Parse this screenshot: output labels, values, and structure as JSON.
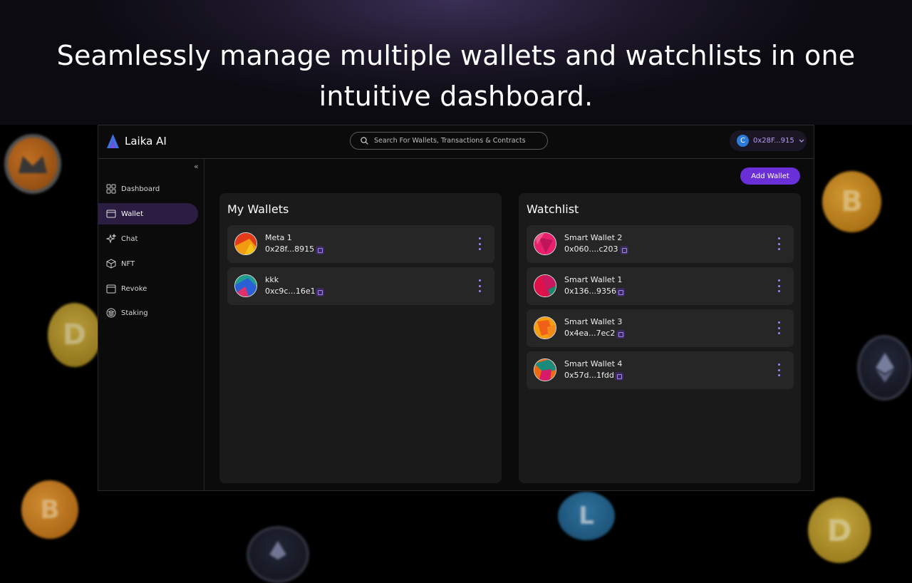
{
  "headline": {
    "line1": "Seamlessly manage multiple wallets and watchlists in one",
    "line2": "intuitive dashboard."
  },
  "app": {
    "brand": "Laika AI",
    "search_placeholder": "Search For Wallets, Transactions & Contracts",
    "account": {
      "initial": "C",
      "address": "0x28F...915"
    },
    "collapse_glyph": "«",
    "nav": [
      {
        "label": "Dashboard",
        "icon": "dashboard-grid-icon",
        "active": false
      },
      {
        "label": "Wallet",
        "icon": "wallet-icon",
        "active": true
      },
      {
        "label": "Chat",
        "icon": "sparkle-icon",
        "active": false
      },
      {
        "label": "NFT",
        "icon": "cube-icon",
        "active": false
      },
      {
        "label": "Revoke",
        "icon": "calendar-icon",
        "active": false
      },
      {
        "label": "Staking",
        "icon": "layers-icon",
        "active": false
      }
    ],
    "add_wallet_label": "Add Wallet",
    "my_wallets": {
      "title": "My Wallets",
      "items": [
        {
          "name": "Meta 1",
          "address": "0x28f...8915"
        },
        {
          "name": "kkk",
          "address": "0xc9c...16e1"
        }
      ]
    },
    "watchlist": {
      "title": "Watchlist",
      "items": [
        {
          "name": "Smart Wallet 2",
          "address": "0x060....c203"
        },
        {
          "name": "Smart Wallet 1",
          "address": "0x136...9356"
        },
        {
          "name": "Smart Wallet 3",
          "address": "0x4ea...7ec2"
        },
        {
          "name": "Smart Wallet 4",
          "address": "0x57d...1fdd"
        }
      ]
    }
  },
  "colors": {
    "accent": "#6a2fd6",
    "active_nav_bg": "#2b1d42",
    "panel_bg": "#1a1a1a",
    "card_bg": "#262626",
    "copy_icon": "#a585f2"
  },
  "decorative_coins": [
    "monero-coin-icon",
    "bitcoin-coin-icon",
    "dogecoin-coin-icon",
    "ethereum-coin-icon",
    "litecoin-coin-icon"
  ]
}
